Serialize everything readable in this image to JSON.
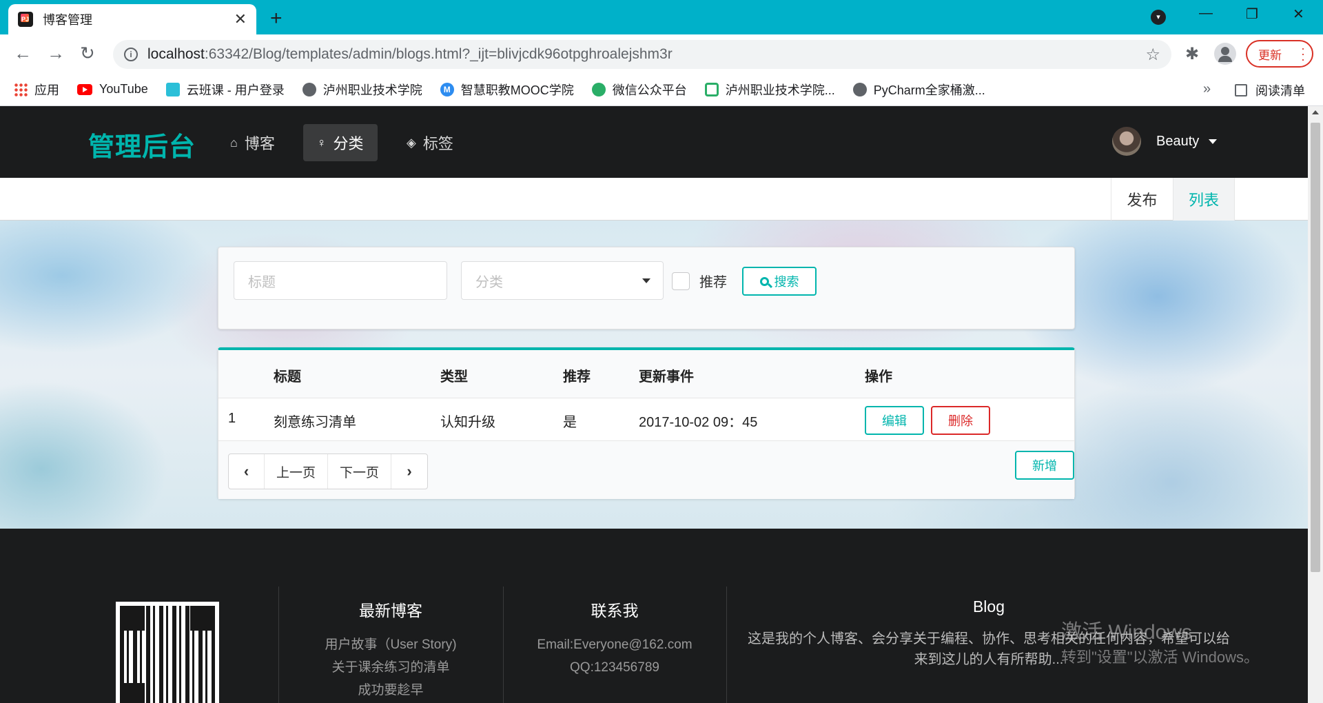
{
  "browser": {
    "tab_title": "博客管理",
    "tab_close": "✕",
    "new_tab": "+",
    "url_host": "localhost",
    "url_rest": ":63342/Blog/templates/admin/blogs.html?_ijt=blivjcdk96otpghroalejshm3r",
    "update_label": "更新",
    "bookmarks": [
      {
        "label": "应用",
        "icon": "apps-icon"
      },
      {
        "label": "YouTube",
        "icon": "youtube-icon"
      },
      {
        "label": "云班课 - 用户登录",
        "icon": "cloud-icon"
      },
      {
        "label": "泸州职业技术学院",
        "icon": "globe-icon"
      },
      {
        "label": "智慧职教MOOC学院",
        "icon": "mooc-icon"
      },
      {
        "label": "微信公众平台",
        "icon": "wechat-icon"
      },
      {
        "label": "泸州职业技术学院...",
        "icon": "dna-icon"
      },
      {
        "label": "PyCharm全家桶激...",
        "icon": "globe-icon"
      }
    ],
    "bookmarks_more": "»",
    "reading_list": "阅读清单"
  },
  "site": {
    "brand": "管理后台",
    "nav": [
      {
        "label": "博客",
        "icon": "home-icon"
      },
      {
        "label": "分类",
        "icon": "idea-icon"
      },
      {
        "label": "标签",
        "icon": "tags-icon"
      }
    ],
    "user_name": "Beauty",
    "subnav": [
      {
        "label": "发布"
      },
      {
        "label": "列表"
      }
    ]
  },
  "search": {
    "title_placeholder": "标题",
    "category_placeholder": "分类",
    "recommend_label": "推荐",
    "search_button": "搜索"
  },
  "table": {
    "headers": [
      "标题",
      "类型",
      "推荐",
      "更新事件",
      "操作"
    ],
    "rows": [
      {
        "index": "1",
        "title": "刻意练习清单",
        "type": "认知升级",
        "recommend": "是",
        "updated": "2017-10-02 09：45",
        "edit": "编辑",
        "delete": "删除"
      }
    ],
    "prev": "上一页",
    "next": "下一页",
    "add": "新增"
  },
  "footer": {
    "col1_title": "最新博客",
    "col1_lines": [
      "用户故事（User Story)",
      "关于课余练习的清单",
      "成功要趁早"
    ],
    "col2_title": "联系我",
    "col2_lines": [
      "Email:Everyone@162.com",
      "QQ:123456789"
    ],
    "col3_title": "Blog",
    "col3_text": "这是我的个人博客、会分享关于编程、协作、思考相关的任何内容，希望可以给来到这儿的人有所帮助..."
  },
  "watermark": {
    "line1": "激活 Windows",
    "line2": "转到\"设置\"以激活 Windows。"
  },
  "colors": {
    "tabbar": "#00b1c9",
    "accent": "#00b5ad",
    "danger": "#db2828",
    "nav_bg": "#1b1c1d"
  }
}
